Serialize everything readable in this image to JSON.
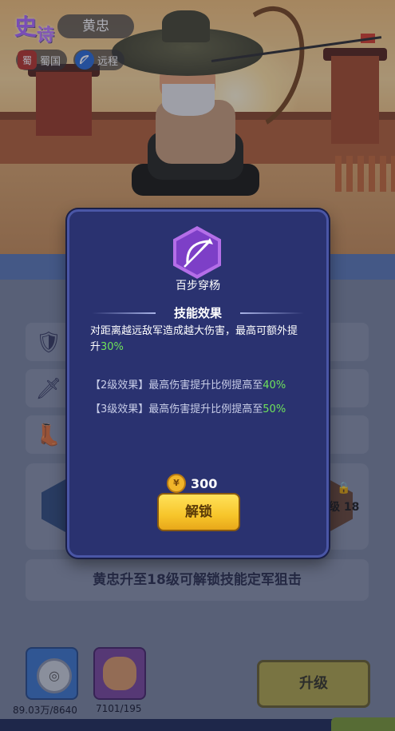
{
  "hero": {
    "rarity_char1": "史",
    "rarity_char2": "诗",
    "name": "黄忠",
    "faction_icon": "蜀",
    "faction": "蜀国",
    "type_icon": "bow-icon",
    "type": "远程"
  },
  "popup": {
    "skill_icon": "bow-arrow-icon",
    "skill_name": "百步穿杨",
    "section_title": "技能效果",
    "description_text": "对距离越远敌军造成越大伤害，最高可额外提升",
    "description_value": "30%",
    "level2_text": "【2级效果】最高伤害提升比例提高至",
    "level2_value": "40%",
    "level3_text": "【3级效果】最高伤害提升比例提高至",
    "level3_value": "50%",
    "cost_icon": "coin-icon",
    "cost": "300",
    "unlock_button": "解锁"
  },
  "panel": {
    "stat_icons": [
      "shield-icon",
      "sword-icon",
      "boot-icon"
    ],
    "locked_skill_level": "级 18",
    "unlock_hint": "黄忠升至18级可解锁技能定军狙击",
    "items": [
      {
        "icon": "coin-icon",
        "count": "89.03万/8640"
      },
      {
        "icon": "hero-shard-icon",
        "count": "7101/195"
      }
    ],
    "upgrade_button": "升级"
  },
  "colors": {
    "popup_bg": "#2a3270",
    "popup_border": "#4a56a6",
    "highlight_green": "#6fe35a",
    "unlock_yellow": "#f7c52a"
  }
}
